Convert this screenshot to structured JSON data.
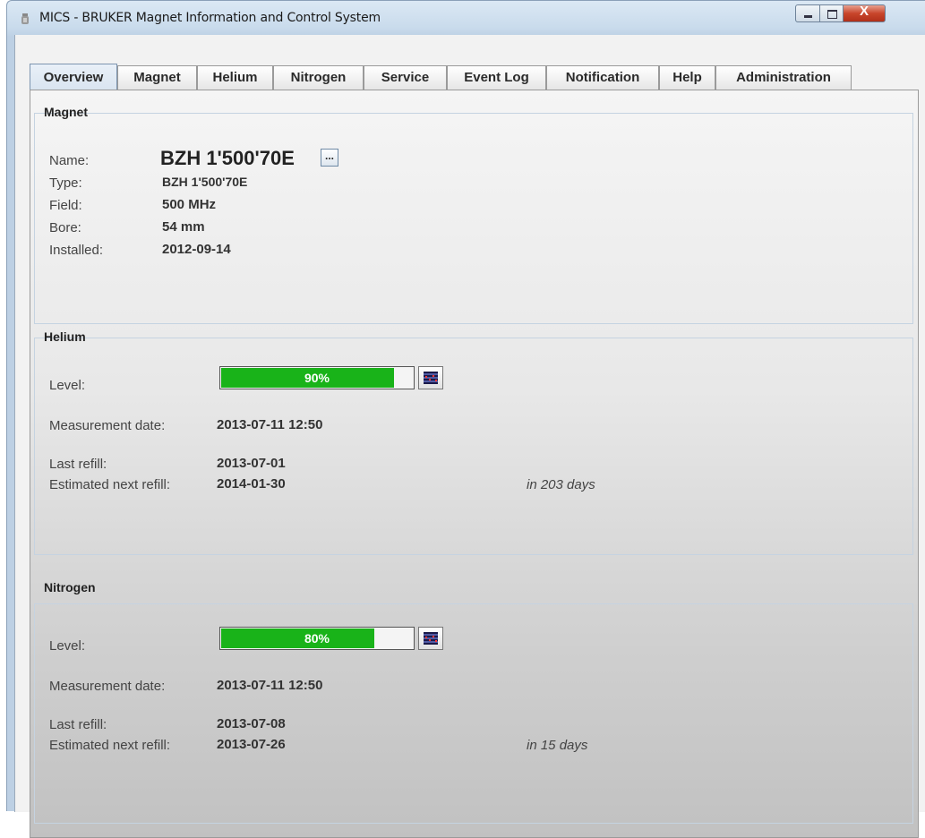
{
  "window": {
    "title": "MICS - BRUKER Magnet Information and Control System",
    "close_label": "X"
  },
  "tabs": [
    {
      "label": "Overview",
      "active": true
    },
    {
      "label": "Magnet"
    },
    {
      "label": "Helium"
    },
    {
      "label": "Nitrogen"
    },
    {
      "label": "Service"
    },
    {
      "label": "Event Log"
    },
    {
      "label": "Notification"
    },
    {
      "label": "Help"
    },
    {
      "label": "Administration"
    }
  ],
  "magnet": {
    "title": "Magnet",
    "name_label": "Name:",
    "name_value": "BZH 1'500'70E",
    "edit_button": "...",
    "type_label": "Type:",
    "type_value": "BZH 1'500'70E",
    "field_label": "Field:",
    "field_value": "500 MHz",
    "bore_label": "Bore:",
    "bore_value": "54 mm",
    "installed_label": "Installed:",
    "installed_value": "2012-09-14"
  },
  "helium": {
    "title": "Helium",
    "level_label": "Level:",
    "level_percent": 90,
    "level_text": "90%",
    "measurement_label": "Measurement date:",
    "measurement_value": "2013-07-11  12:50",
    "last_refill_label": "Last refill:",
    "last_refill_value": "2013-07-01",
    "next_refill_label": "Estimated next refill:",
    "next_refill_value": "2014-01-30",
    "next_refill_in": "in 203 days"
  },
  "nitrogen": {
    "title": "Nitrogen",
    "level_label": "Level:",
    "level_percent": 80,
    "level_text": "80%",
    "measurement_label": "Measurement date:",
    "measurement_value": "2013-07-11  12:50",
    "last_refill_label": "Last refill:",
    "last_refill_value": "2013-07-08",
    "next_refill_label": "Estimated next refill:",
    "next_refill_value": "2013-07-26",
    "next_refill_in": "in 15 days"
  },
  "colors": {
    "level_fill": "#19b319",
    "level_empty": "#f4f4f4"
  }
}
